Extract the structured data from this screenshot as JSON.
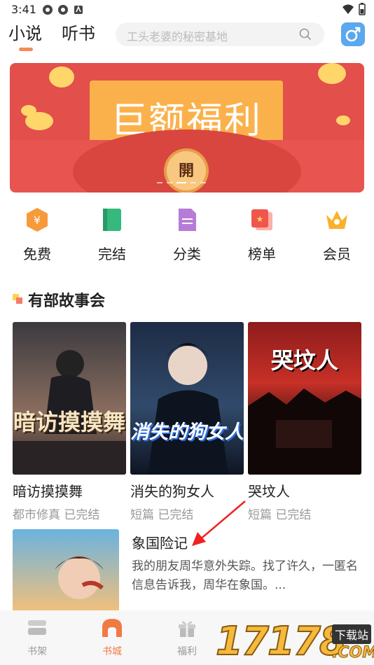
{
  "status": {
    "time": "3:41"
  },
  "topnav": {
    "tabs": [
      {
        "label": "小说",
        "active": true
      },
      {
        "label": "听书",
        "active": false
      }
    ],
    "search_placeholder": "工头老婆的秘密基地"
  },
  "banner": {
    "title": "巨额福利",
    "seal": "開"
  },
  "quick_links": [
    {
      "label": "免费",
      "icon": "coin-hexagon-icon"
    },
    {
      "label": "完结",
      "icon": "book-icon"
    },
    {
      "label": "分类",
      "icon": "document-list-icon"
    },
    {
      "label": "榜单",
      "icon": "ranking-card-icon"
    },
    {
      "label": "会员",
      "icon": "crown-icon"
    }
  ],
  "section": {
    "title": "有部故事会"
  },
  "books": [
    {
      "title": "暗访摸摸舞",
      "meta": "都市修真 已完结",
      "cover_text": "暗访摸摸舞"
    },
    {
      "title": "消失的狗女人",
      "meta": "短篇 已完结",
      "cover_text": "消失的狗女人"
    },
    {
      "title": "哭坟人",
      "meta": "短篇 已完结",
      "cover_text": "哭坟人"
    }
  ],
  "feature": {
    "title": "象国险记",
    "desc": "我的朋友周华意外失踪。找了许久，一匿名信息告诉我，周华在象国。..."
  },
  "bottom_nav": [
    {
      "label": "书架",
      "active": false,
      "icon": "bookshelf-icon"
    },
    {
      "label": "书城",
      "active": true,
      "icon": "bookstore-icon"
    },
    {
      "label": "福利",
      "active": false,
      "icon": "gift-icon"
    }
  ],
  "watermark": {
    "number": "17178",
    "site": "下载站",
    "suffix": ".COM"
  },
  "colors": {
    "accent": "#f07a44",
    "banner_red": "#e34f4b",
    "banner_gold": "#fbb14b"
  }
}
